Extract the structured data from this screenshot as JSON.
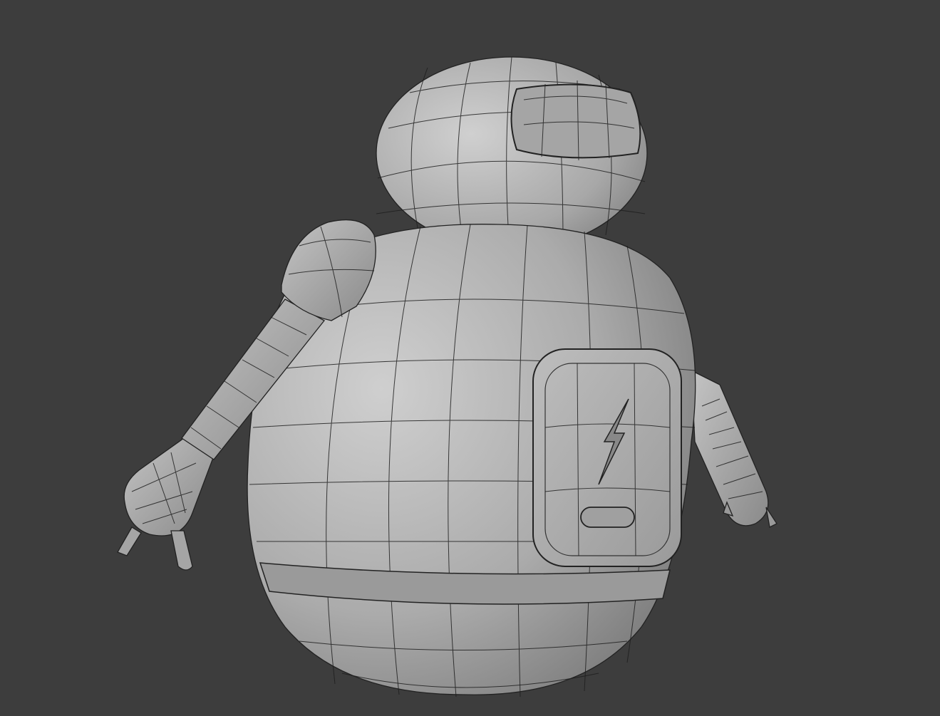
{
  "scene": {
    "background_color": "#3d3d3d",
    "model_color": "#b4b4b4",
    "wire_color": "#1e1e1e",
    "display_mode": "solid-with-wireframe"
  }
}
